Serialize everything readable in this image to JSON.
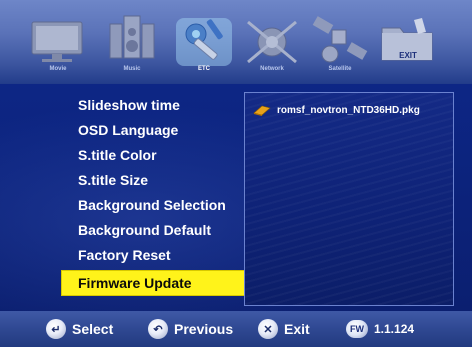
{
  "top_menu": {
    "items": [
      {
        "label": "Movie",
        "icon": "tv-icon",
        "active": false
      },
      {
        "label": "Music",
        "icon": "speaker-icon",
        "active": false
      },
      {
        "label": "ETC",
        "icon": "tools-icon",
        "active": true
      },
      {
        "label": "Network",
        "icon": "network-icon",
        "active": false
      },
      {
        "label": "Satellite",
        "icon": "satellite-icon",
        "active": false
      },
      {
        "label": "EXIT",
        "icon": "folder-exit-icon",
        "active": false
      }
    ]
  },
  "menu": {
    "items": [
      "Slideshow time",
      "OSD Language",
      "S.title Color",
      "S.title Size",
      "Background Selection",
      "Background Default",
      "Factory Reset",
      "Firmware Update"
    ],
    "selected": "Firmware Update"
  },
  "file_panel": {
    "files": [
      {
        "name": "romsf_novtron_NTD36HD.pkg",
        "icon": "package-file-icon"
      }
    ]
  },
  "footer": {
    "select_label": "Select",
    "previous_label": "Previous",
    "exit_label": "Exit",
    "fw_badge": "FW",
    "fw_version": "1.1.124"
  },
  "colors": {
    "background": "#0b1f78",
    "highlight": "#fff31a",
    "text": "#ffffff"
  }
}
